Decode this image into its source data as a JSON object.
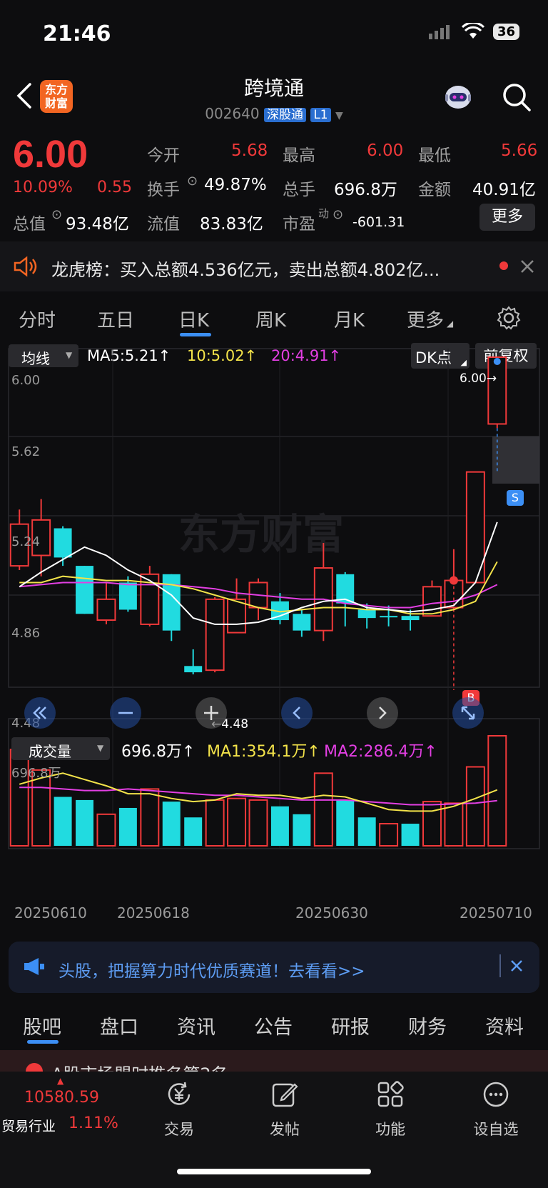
{
  "status": {
    "time": "21:46",
    "battery": "36"
  },
  "header": {
    "logo_line1": "东方",
    "logo_line2": "财富",
    "name": "跨境通",
    "code": "002640",
    "tag_connect": "深股通",
    "tag_level": "L1"
  },
  "quote": {
    "price": "6.00",
    "pct": "10.09%",
    "change": "0.55",
    "open_label": "今开",
    "open": "5.68",
    "high_label": "最高",
    "high": "6.00",
    "low_label": "最低",
    "low": "5.66",
    "turnover_label": "换手",
    "turnover": "49.87%",
    "volume_label": "总手",
    "volume": "696.8万",
    "amount_label": "金额",
    "amount": "40.91亿",
    "mcap_label": "总值",
    "mcap": "93.48亿",
    "float_label": "流值",
    "float": "83.83亿",
    "pe_label": "市盈",
    "pe_sup": "动",
    "pe": "-601.31",
    "more": "更多"
  },
  "notice": {
    "title": "龙虎榜：",
    "text": "买入总额4.536亿元，卖出总额4.802亿..."
  },
  "ktabs": [
    "分时",
    "五日",
    "日K",
    "周K",
    "月K",
    "更多"
  ],
  "chart_legend": {
    "ma_selector": "均线",
    "ma5": "MA5:5.21↑",
    "ma10": "10:5.02↑",
    "ma20": "20:4.91↑",
    "dk": "DK点",
    "adjust": "前复权"
  },
  "chart_labels": {
    "y_top": "6.00",
    "y_2": "5.62",
    "y_3": "5.24",
    "y_4": "4.86",
    "y_bottom": "4.48",
    "high_mark": "6.00→",
    "low_mark": "←4.48",
    "watermark": "东方财富",
    "sell": "S",
    "buy": "B"
  },
  "volume_legend": {
    "selector": "成交量",
    "vol": "696.8万↑",
    "ma1": "MA1:354.1万↑",
    "ma2": "MA2:286.4万↑",
    "top": "696.8万"
  },
  "dates": [
    "20250610",
    "20250618",
    "20250630",
    "20250710"
  ],
  "ad": {
    "text": "头股，把握算力时代优质赛道！去看看>>"
  },
  "btabs": [
    "股吧",
    "盘口",
    "资讯",
    "公告",
    "研报",
    "财务",
    "资料"
  ],
  "partial_text": "A股市场盟时推名第2名",
  "bottom_nav": {
    "index_value": "10580.59",
    "index_name": "贸易行业",
    "index_pct": "1.11%",
    "trade": "交易",
    "post": "发帖",
    "function": "功能",
    "watchlist": "设自选"
  },
  "colors": {
    "up": "#f0393a",
    "down": "#21dbe0",
    "ma5": "#ffffff",
    "ma10": "#f3e34a",
    "ma20": "#e33fe3",
    "accent": "#3c8ff5"
  },
  "chart_data": {
    "type": "candlestick",
    "ylim": [
      4.48,
      6.0
    ],
    "candles": [
      {
        "o": 5.0,
        "c": 5.2,
        "h": 5.27,
        "l": 4.98,
        "up": true
      },
      {
        "o": 5.05,
        "c": 5.22,
        "h": 5.32,
        "l": 4.95,
        "up": true
      },
      {
        "o": 5.18,
        "c": 5.04,
        "h": 5.19,
        "l": 5.0,
        "up": false
      },
      {
        "o": 5.0,
        "c": 4.77,
        "h": 5.0,
        "l": 4.77,
        "up": false
      },
      {
        "o": 4.74,
        "c": 4.84,
        "h": 4.92,
        "l": 4.72,
        "up": true
      },
      {
        "o": 4.92,
        "c": 4.79,
        "h": 4.95,
        "l": 4.78,
        "up": false
      },
      {
        "o": 4.72,
        "c": 4.96,
        "h": 5.0,
        "l": 4.71,
        "up": true
      },
      {
        "o": 4.96,
        "c": 4.69,
        "h": 4.96,
        "l": 4.64,
        "up": false
      },
      {
        "o": 4.52,
        "c": 4.49,
        "h": 4.6,
        "l": 4.48,
        "up": false
      },
      {
        "o": 4.5,
        "c": 4.84,
        "h": 4.85,
        "l": 4.49,
        "up": true
      },
      {
        "o": 4.68,
        "c": 4.84,
        "h": 4.94,
        "l": 4.68,
        "up": true
      },
      {
        "o": 4.8,
        "c": 4.92,
        "h": 4.94,
        "l": 4.74,
        "up": true
      },
      {
        "o": 4.83,
        "c": 4.74,
        "h": 4.87,
        "l": 4.72,
        "up": false
      },
      {
        "o": 4.77,
        "c": 4.69,
        "h": 4.79,
        "l": 4.66,
        "up": false
      },
      {
        "o": 4.69,
        "c": 4.99,
        "h": 5.11,
        "l": 4.64,
        "up": true
      },
      {
        "o": 4.96,
        "c": 4.82,
        "h": 4.97,
        "l": 4.71,
        "up": false
      },
      {
        "o": 4.79,
        "c": 4.75,
        "h": 4.82,
        "l": 4.7,
        "up": false
      },
      {
        "o": 4.76,
        "c": 4.76,
        "h": 4.81,
        "l": 4.71,
        "up": false
      },
      {
        "o": 4.76,
        "c": 4.74,
        "h": 4.79,
        "l": 4.69,
        "up": false
      },
      {
        "o": 4.76,
        "c": 4.9,
        "h": 4.93,
        "l": 4.76,
        "up": true
      },
      {
        "o": 4.8,
        "c": 4.93,
        "h": 5.08,
        "l": 4.79,
        "up": true
      },
      {
        "o": 4.92,
        "c": 5.45,
        "h": 5.45,
        "l": 4.92,
        "up": true
      },
      {
        "o": 5.68,
        "c": 6.0,
        "h": 6.0,
        "l": 5.66,
        "up": true
      }
    ],
    "ma5": [
      4.9,
      4.97,
      5.03,
      5.09,
      5.05,
      4.98,
      4.93,
      4.86,
      4.75,
      4.72,
      4.72,
      4.73,
      4.76,
      4.8,
      4.83,
      4.84,
      4.8,
      4.79,
      4.78,
      4.79,
      4.81,
      4.92,
      5.21
    ],
    "ma10": [
      4.92,
      4.92,
      4.95,
      4.94,
      4.93,
      4.93,
      4.92,
      4.91,
      4.89,
      4.86,
      4.83,
      4.8,
      4.78,
      4.79,
      4.8,
      4.8,
      4.79,
      4.79,
      4.77,
      4.77,
      4.79,
      4.83,
      5.02
    ],
    "ma20": [
      4.9,
      4.91,
      4.92,
      4.92,
      4.92,
      4.91,
      4.91,
      4.91,
      4.9,
      4.89,
      4.87,
      4.86,
      4.85,
      4.84,
      4.84,
      4.82,
      4.81,
      4.8,
      4.8,
      4.82,
      4.83,
      4.86,
      4.91
    ],
    "volume": {
      "ylim": [
        0,
        696.8
      ],
      "bars": [
        {
          "v": 610,
          "up": true
        },
        {
          "v": 480,
          "up": true
        },
        {
          "v": 310,
          "up": false
        },
        {
          "v": 290,
          "up": false
        },
        {
          "v": 200,
          "up": true
        },
        {
          "v": 240,
          "up": false
        },
        {
          "v": 360,
          "up": true
        },
        {
          "v": 280,
          "up": false
        },
        {
          "v": 180,
          "up": false
        },
        {
          "v": 290,
          "up": true
        },
        {
          "v": 300,
          "up": true
        },
        {
          "v": 290,
          "up": true
        },
        {
          "v": 250,
          "up": false
        },
        {
          "v": 200,
          "up": false
        },
        {
          "v": 460,
          "up": true
        },
        {
          "v": 290,
          "up": false
        },
        {
          "v": 180,
          "up": false
        },
        {
          "v": 140,
          "up": true
        },
        {
          "v": 140,
          "up": false
        },
        {
          "v": 280,
          "up": true
        },
        {
          "v": 270,
          "up": true
        },
        {
          "v": 500,
          "up": true
        },
        {
          "v": 696.8,
          "up": true
        }
      ],
      "ma1": [
        390,
        430,
        460,
        420,
        380,
        330,
        330,
        300,
        280,
        290,
        330,
        320,
        320,
        300,
        320,
        310,
        270,
        230,
        220,
        220,
        250,
        300,
        354.1
      ],
      "ma2": [
        370,
        370,
        360,
        350,
        350,
        360,
        350,
        340,
        330,
        320,
        320,
        310,
        300,
        290,
        290,
        290,
        280,
        270,
        260,
        260,
        265,
        270,
        286.4
      ]
    }
  }
}
